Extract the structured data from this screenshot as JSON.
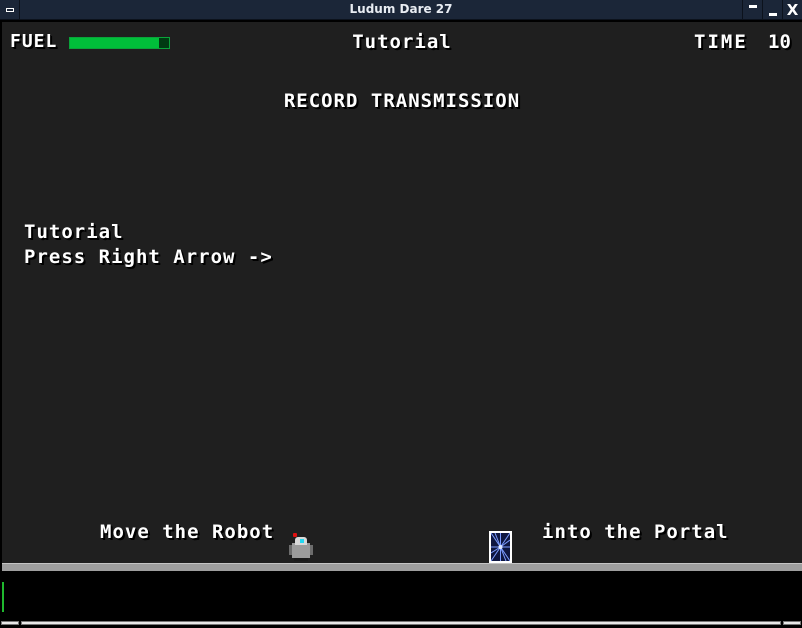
{
  "window": {
    "title": "Ludum Dare 27",
    "buttons": [
      "menu",
      "shade",
      "minimize",
      "close"
    ],
    "close_glyph": "X"
  },
  "hud": {
    "fuel_label": "FUEL",
    "fuel_level": 0.9,
    "level_name": "Tutorial",
    "time_label": "TIME",
    "time_value": "10"
  },
  "transmission": {
    "heading": "RECORD TRANSMISSION",
    "lines": [
      "Tutorial",
      "Press Right Arrow ->"
    ]
  },
  "scene": {
    "hint_left": "Move the Robot",
    "hint_right": "into the Portal",
    "player": "robot",
    "goal": "portal"
  },
  "colors": {
    "fuel_fill": "#00bf3a",
    "fuel_empty": "#003a12",
    "background": "#1f1f1f",
    "ground": "#9e9e9e",
    "titlebar": "#1b2638",
    "cursor": "#1fb82e"
  }
}
